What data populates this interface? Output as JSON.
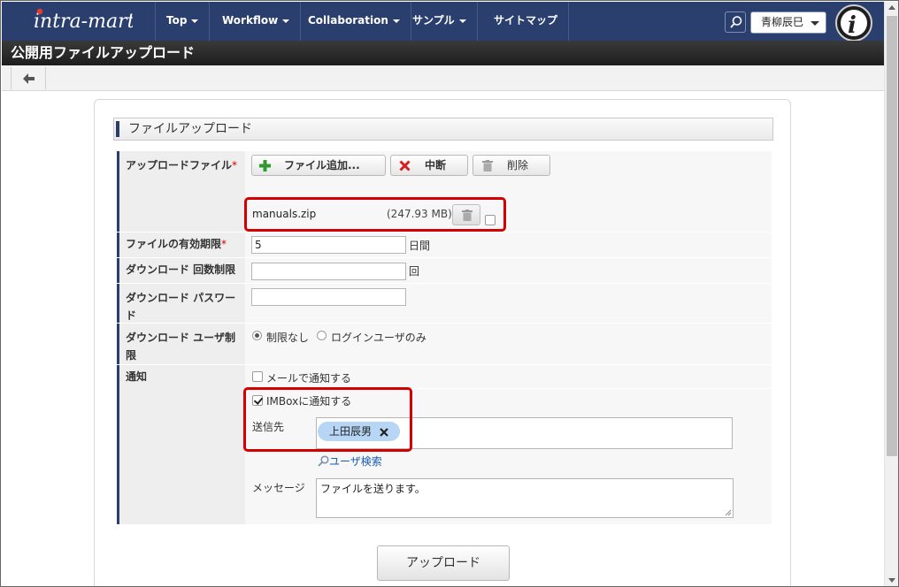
{
  "header": {
    "logo_text": "intra-mart",
    "nav": [
      {
        "label": "Top",
        "has_dropdown": true
      },
      {
        "label": "Workflow",
        "has_dropdown": true
      },
      {
        "label": "Collaboration",
        "has_dropdown": true
      },
      {
        "label": "サンプル",
        "has_dropdown": true
      },
      {
        "label": "サイトマップ",
        "has_dropdown": false
      }
    ],
    "user_name": "青柳辰巳",
    "icons": {
      "search": "search-icon",
      "user_menu": "chevron-down-icon",
      "badge": "intramart-i-icon"
    }
  },
  "page": {
    "title": "公開用ファイルアップロード",
    "back_icon": "arrow-left-icon"
  },
  "form": {
    "section_title": "ファイルアップロード",
    "upload_file": {
      "label": "アップロードファイル",
      "required_mark": "*",
      "buttons": {
        "add": "ファイル追加...",
        "cancel": "中断",
        "delete": "削除"
      },
      "file": {
        "name": "manuals.zip",
        "size": "(247.93 MB)"
      }
    },
    "expiry": {
      "label": "ファイルの有効期限",
      "required_mark": "*",
      "value": "5",
      "unit": "日間"
    },
    "download_limit": {
      "label": "ダウンロード 回数制限",
      "value": "",
      "unit": "回"
    },
    "download_password": {
      "label": "ダウンロード パスワード",
      "value": ""
    },
    "download_user_limit": {
      "label": "ダウンロード ユーザ制限",
      "options": [
        {
          "label": "制限なし",
          "selected": true
        },
        {
          "label": "ログインユーザのみ",
          "selected": false
        }
      ]
    },
    "notify": {
      "label": "通知",
      "mail_label": "メールで通知する",
      "mail_checked": false,
      "imbox_label": "IMBoxに通知する",
      "imbox_checked": true,
      "recipients_label": "送信先",
      "recipients": [
        "上田辰男"
      ],
      "user_search_label": "ユーザ検索",
      "message_label": "メッセージ",
      "message_value": "ファイルを送ります。"
    },
    "submit_label": "アップロード"
  },
  "colors": {
    "nav_bg": "#2b3f6e",
    "title_bg": "#262626",
    "highlight": "#d40000",
    "chip_bg": "#b7d6f5",
    "link": "#1a5db4"
  }
}
